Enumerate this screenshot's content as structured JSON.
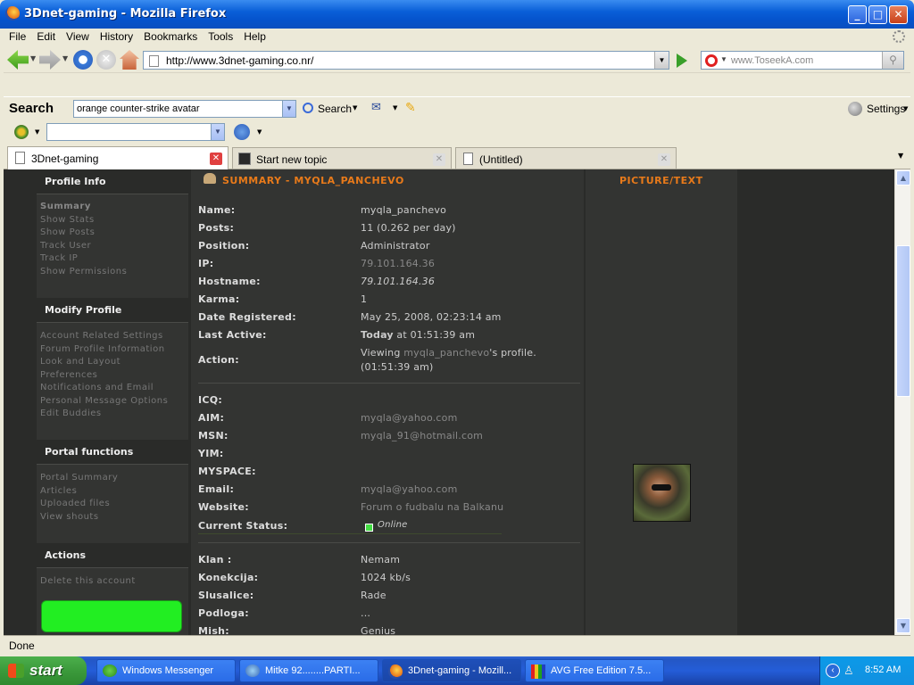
{
  "window": {
    "title": "3Dnet-gaming - Mozilla Firefox"
  },
  "menu": [
    "File",
    "Edit",
    "View",
    "History",
    "Bookmarks",
    "Tools",
    "Help"
  ],
  "nav": {
    "url": "http://www.3dnet-gaming.co.nr/",
    "search_placeholder": "www.ToseekA.com"
  },
  "toolbar_search": {
    "label": "Search",
    "query": "orange counter-strike avatar",
    "search_btn": "Search",
    "settings": "Settings"
  },
  "tabs": [
    {
      "label": "3Dnet-gaming",
      "active": true
    },
    {
      "label": "Start new topic",
      "active": false
    },
    {
      "label": "(Untitled)",
      "active": false
    }
  ],
  "sidebar": {
    "profile_info": {
      "title": "Profile Info",
      "links": [
        "Summary",
        "Show Stats",
        "Show Posts",
        "Track User",
        "Track IP",
        "Show Permissions"
      ]
    },
    "modify_profile": {
      "title": "Modify Profile",
      "links": [
        "Account Related Settings",
        "Forum Profile Information",
        "Look and Layout",
        "Preferences",
        "Notifications and Email",
        "Personal Message Options",
        "Edit Buddies"
      ]
    },
    "portal": {
      "title": "Portal functions",
      "links": [
        "Portal Summary",
        "Articles",
        "Uploaded files",
        "View shouts"
      ]
    },
    "actions": {
      "title": "Actions",
      "links": [
        "Delete this account"
      ]
    }
  },
  "summary": {
    "header": "SUMMARY - MYQLA_PANCHEVO",
    "picture_header": "PICTURE/TEXT",
    "rows1": [
      {
        "label": "Name:",
        "value": "myqla_panchevo"
      },
      {
        "label": "Posts:",
        "value": "11 (0.262 per day)"
      },
      {
        "label": "Position:",
        "value": "Administrator"
      },
      {
        "label": "IP:",
        "value": "79.101.164.36"
      },
      {
        "label": "Hostname:",
        "value": "79.101.164.36"
      },
      {
        "label": "Karma:",
        "value": "1"
      },
      {
        "label": "Date Registered:",
        "value": "May 25, 2008, 02:23:14 am"
      },
      {
        "label": "Last Active:",
        "value_bold": "Today",
        "value": " at 01:51:39 am"
      }
    ],
    "action": {
      "label": "Action:",
      "line1_pre": "Viewing ",
      "line1_link": "myqla_panchevo",
      "line1_post": "'s profile.",
      "line2": "(01:51:39 am)"
    },
    "rows2": [
      {
        "label": "ICQ:",
        "value": ""
      },
      {
        "label": "AIM:",
        "value": "myqla@yahoo.com"
      },
      {
        "label": "MSN:",
        "value": "myqla_91@hotmail.com"
      },
      {
        "label": "YIM:",
        "value": ""
      },
      {
        "label": "MYSPACE:",
        "value": ""
      },
      {
        "label": "Email:",
        "value": "myqla@yahoo.com"
      },
      {
        "label": "Website:",
        "value": "Forum o fudbalu na Balkanu"
      },
      {
        "label": "Current Status:",
        "value": "Online"
      }
    ],
    "rows3": [
      {
        "label": "Klan :",
        "value": "Nemam"
      },
      {
        "label": "Konekcija:",
        "value": "1024 kb/s"
      },
      {
        "label": "Slusalice:",
        "value": "Rade"
      },
      {
        "label": "Podloga:",
        "value": "..."
      },
      {
        "label": "Mish:",
        "value": "Genius"
      }
    ]
  },
  "status": "Done",
  "taskbar": {
    "start": "start",
    "items": [
      "Windows Messenger",
      "Mitke 92........PARTI...",
      "3Dnet-gaming - Mozill...",
      "AVG Free Edition  7.5..."
    ],
    "clock": "8:52 AM"
  },
  "colors": {
    "accent_orange": "#e87a1a",
    "online_green": "#22ee22",
    "page_bg": "#2a2b29"
  }
}
